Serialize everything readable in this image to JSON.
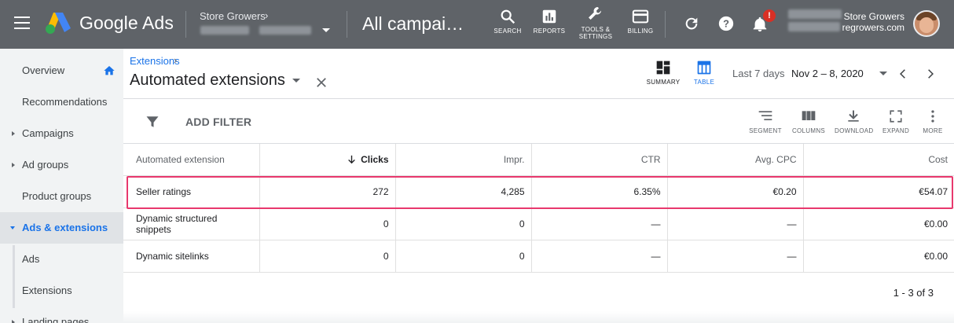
{
  "header": {
    "brand": "Google Ads",
    "account_name": "Store Growers",
    "account_chevron": "›",
    "page_name": "All campai…",
    "tools": [
      {
        "icon": "search-icon",
        "label": "SEARCH"
      },
      {
        "icon": "reports-icon",
        "label": "REPORTS"
      },
      {
        "icon": "wrench-icon",
        "label": "TOOLS &\nSETTINGS"
      },
      {
        "icon": "billing-card-icon",
        "label": "BILLING"
      }
    ],
    "notification_badge": "!",
    "user_line1": "Store Growers",
    "user_line2": "regrowers.com"
  },
  "sidebar": {
    "items": [
      {
        "label": "Overview"
      },
      {
        "label": "Recommendations"
      },
      {
        "label": "Campaigns"
      },
      {
        "label": "Ad groups"
      },
      {
        "label": "Product groups"
      },
      {
        "label": "Ads & extensions"
      },
      {
        "label": "Ads"
      },
      {
        "label": "Extensions"
      },
      {
        "label": "Landing pages"
      }
    ]
  },
  "main": {
    "breadcrumb": "Extensions",
    "breadcrumb_sep": "›",
    "title": "Automated extensions",
    "view_summary": "SUMMARY",
    "view_table": "TABLE",
    "date_label": "Last 7 days",
    "date_value": "Nov 2 – 8, 2020",
    "add_filter": "ADD FILTER",
    "toolbar": {
      "segment": "SEGMENT",
      "columns": "COLUMNS",
      "download": "DOWNLOAD",
      "expand": "EXPAND",
      "more": "MORE"
    },
    "columns": [
      "Automated extension",
      "Clicks",
      "Impr.",
      "CTR",
      "Avg. CPC",
      "Cost"
    ],
    "rows": [
      [
        "Seller ratings",
        "272",
        "4,285",
        "6.35%",
        "€0.20",
        "€54.07"
      ],
      [
        "Dynamic structured snippets",
        "0",
        "0",
        "—",
        "—",
        "€0.00"
      ],
      [
        "Dynamic sitelinks",
        "0",
        "0",
        "—",
        "—",
        "€0.00"
      ]
    ],
    "pager": "1 - 3 of 3"
  },
  "colors": {
    "topbar": "#5f6368",
    "accent": "#1a73e8",
    "highlight": "#e8386d",
    "badge": "#d93025"
  }
}
